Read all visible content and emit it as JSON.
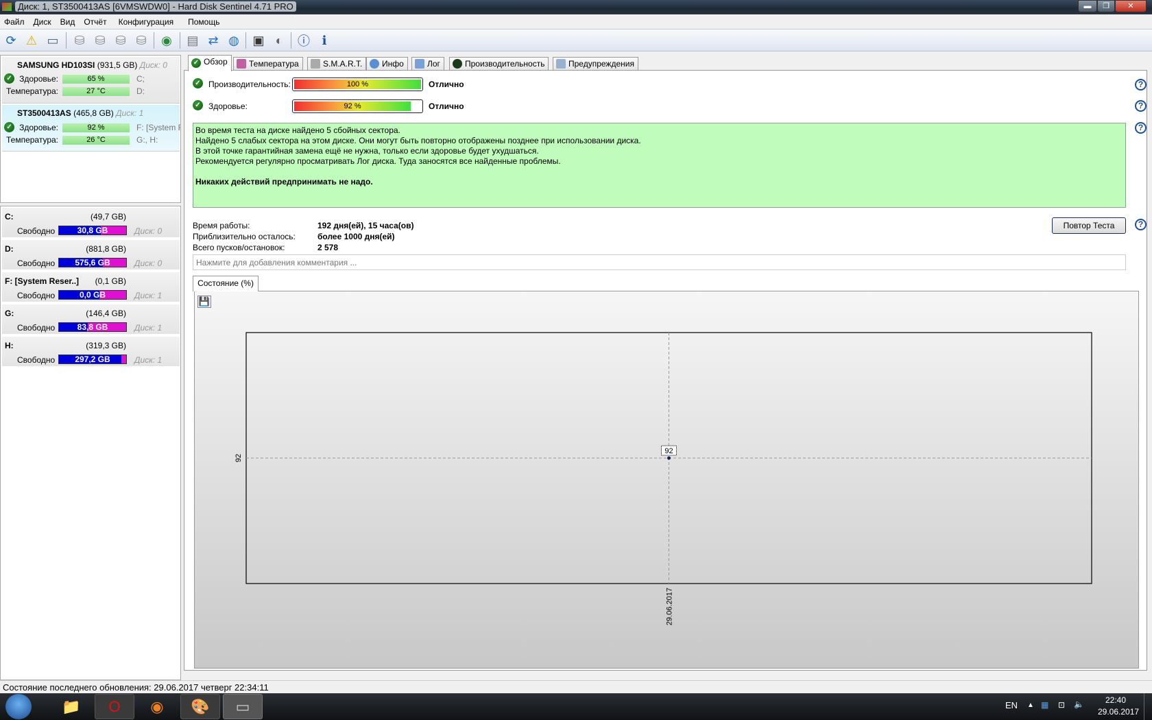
{
  "window": {
    "title": "Диск: 1, ST3500413AS [6VMSWDW0]  -  Hard Disk Sentinel 4.71 PRO"
  },
  "menu": [
    "Файл",
    "Диск",
    "Вид",
    "Отчёт",
    "Конфигурация",
    "Помощь"
  ],
  "toolbar": [
    "refresh-icon",
    "alert-icon",
    "disk-info-icon",
    "disk-surface-icon",
    "disk-timer-icon",
    "disk-check-icon",
    "disk-search-icon",
    "globe-disk-icon",
    "report-icon",
    "send-icon",
    "network-icon",
    "settings-icon",
    "sound-icon",
    "help-icon",
    "about-icon"
  ],
  "disks": [
    {
      "name": "SAMSUNG HD103SI",
      "size": "(931,5 GB)",
      "disk": "Диск: 0",
      "health_label": "Здоровье:",
      "health": "65 %",
      "temp_label": "Температура:",
      "temp": "27 °C",
      "letters1": "C;",
      "letters2": "D:"
    },
    {
      "name": "ST3500413AS",
      "size": "(465,8 GB)",
      "disk": "Диск: 1",
      "health_label": "Здоровье:",
      "health": "92 %",
      "temp_label": "Температура:",
      "temp": "26 °C",
      "letters1": "F: [System Re",
      "letters2": "G:, H:"
    }
  ],
  "partitions": [
    {
      "name": "C:",
      "size": "(49,7 GB)",
      "free_label": "Свободно",
      "free": "30,8 GB",
      "free_pct": 62,
      "disk": "Диск: 0"
    },
    {
      "name": "D:",
      "size": "(881,8 GB)",
      "free_label": "Свободно",
      "free": "575,6 GB",
      "free_pct": 65,
      "disk": "Диск: 0"
    },
    {
      "name": "F: [System Reser..]",
      "size": "(0,1 GB)",
      "free_label": "Свободно",
      "free": "0,0 GB",
      "free_pct": 60,
      "disk": "Диск: 1"
    },
    {
      "name": "G:",
      "size": "(146,4 GB)",
      "free_label": "Свободно",
      "free": "83,8 GB",
      "free_pct": 43,
      "disk": "Диск: 1"
    },
    {
      "name": "H:",
      "size": "(319,3 GB)",
      "free_label": "Свободно",
      "free": "297,2 GB",
      "free_pct": 93,
      "disk": "Диск: 1"
    }
  ],
  "tabs": [
    "Обзор",
    "Температура",
    "S.M.A.R.T.",
    "Инфо",
    "Лог",
    "Производительность",
    "Предупреждения"
  ],
  "overview": {
    "perf_label": "Производительность:",
    "perf": "100 %",
    "perf_pct": 100,
    "perf_status": "Отлично",
    "health_label": "Здоровье:",
    "health": "92 %",
    "health_pct": 92,
    "health_status": "Отлично",
    "message": [
      "Во время теста на диске найдено 5 сбойных сектора.",
      "Найдено 5 слабых сектора на этом диске. Они могут быть повторно отображены позднее при использовании диска.",
      "В этой точке гарантийная замена ещё не нужна, только если здоровье будет ухудшаться.",
      "Рекомендуется регулярно просматривать Лог диска. Туда заносятся все найденные проблемы."
    ],
    "message_bold": "Никаких действий предпринимать не надо.",
    "uptime_label": "Время работы:",
    "uptime": "192 дня(ей), 15 часа(ов)",
    "remaining_label": "Приблизительно осталось:",
    "remaining": "более 1000 дня(ей)",
    "starts_label": "Всего пусков/остановок:",
    "starts": "2 578",
    "retest": "Повтор Теста",
    "comment_placeholder": "Нажмите для добавления комментария ...",
    "chart_tab": "Состояние (%)"
  },
  "chart_data": {
    "type": "line",
    "title": "Состояние (%)",
    "x": [
      "29.06.2017"
    ],
    "series": [
      {
        "name": "Здоровье",
        "values": [
          92
        ]
      }
    ],
    "ytick_labels": [
      "92"
    ],
    "xtick_labels": [
      "29.06.2017"
    ],
    "data_labels": [
      "92"
    ],
    "grid": true
  },
  "statusbar": "Состояние последнего обновления: 29.06.2017 четверг 22:34:11",
  "taskbar": {
    "lang": "EN",
    "time": "22:40",
    "date": "29.06.2017"
  }
}
